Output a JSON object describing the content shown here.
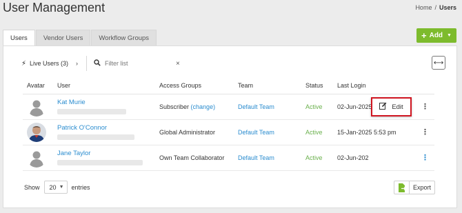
{
  "page": {
    "title": "User Management"
  },
  "breadcrumb": {
    "home": "Home",
    "separator": "/",
    "current": "Users"
  },
  "tabs": [
    {
      "label": "Users",
      "active": true
    },
    {
      "label": "Vendor Users",
      "active": false
    },
    {
      "label": "Workflow Groups",
      "active": false
    }
  ],
  "add_button": {
    "label": "Add",
    "color": "#7dbb2d"
  },
  "toolbar": {
    "live_users_label": "Live Users (3)",
    "search_placeholder": "Filter list",
    "clear_glyph": "×",
    "expand_glyph": "⟷"
  },
  "table": {
    "headers": {
      "avatar": "Avatar",
      "user": "User",
      "access": "Access Groups",
      "team": "Team",
      "status": "Status",
      "login": "Last Login"
    },
    "rows": [
      {
        "name": "Kat Murie",
        "access": "Subscriber",
        "access_link": "(change)",
        "team": "Default Team",
        "status": "Active",
        "last_login": "02-Jun-2025 10:59 am",
        "avatar": "placeholder"
      },
      {
        "name": "Patrick O'Connor",
        "access": "Global Administrator",
        "access_link": "",
        "team": "Default Team",
        "status": "Active",
        "last_login": "15-Jan-2025 5:53 pm",
        "avatar": "photo"
      },
      {
        "name": "Jane Taylor",
        "access": "Own Team Collaborator",
        "access_link": "",
        "team": "Default Team",
        "status": "Active",
        "last_login": "02-Jun-202",
        "avatar": "placeholder"
      }
    ]
  },
  "row_menu": {
    "edit_label": "Edit",
    "highlight_color": "#d0141f"
  },
  "footer": {
    "show_label": "Show",
    "page_size": "20",
    "entries_label": "entries",
    "export_label": "Export"
  },
  "colors": {
    "link": "#2a8ccf",
    "status_active": "#6ab04c"
  }
}
